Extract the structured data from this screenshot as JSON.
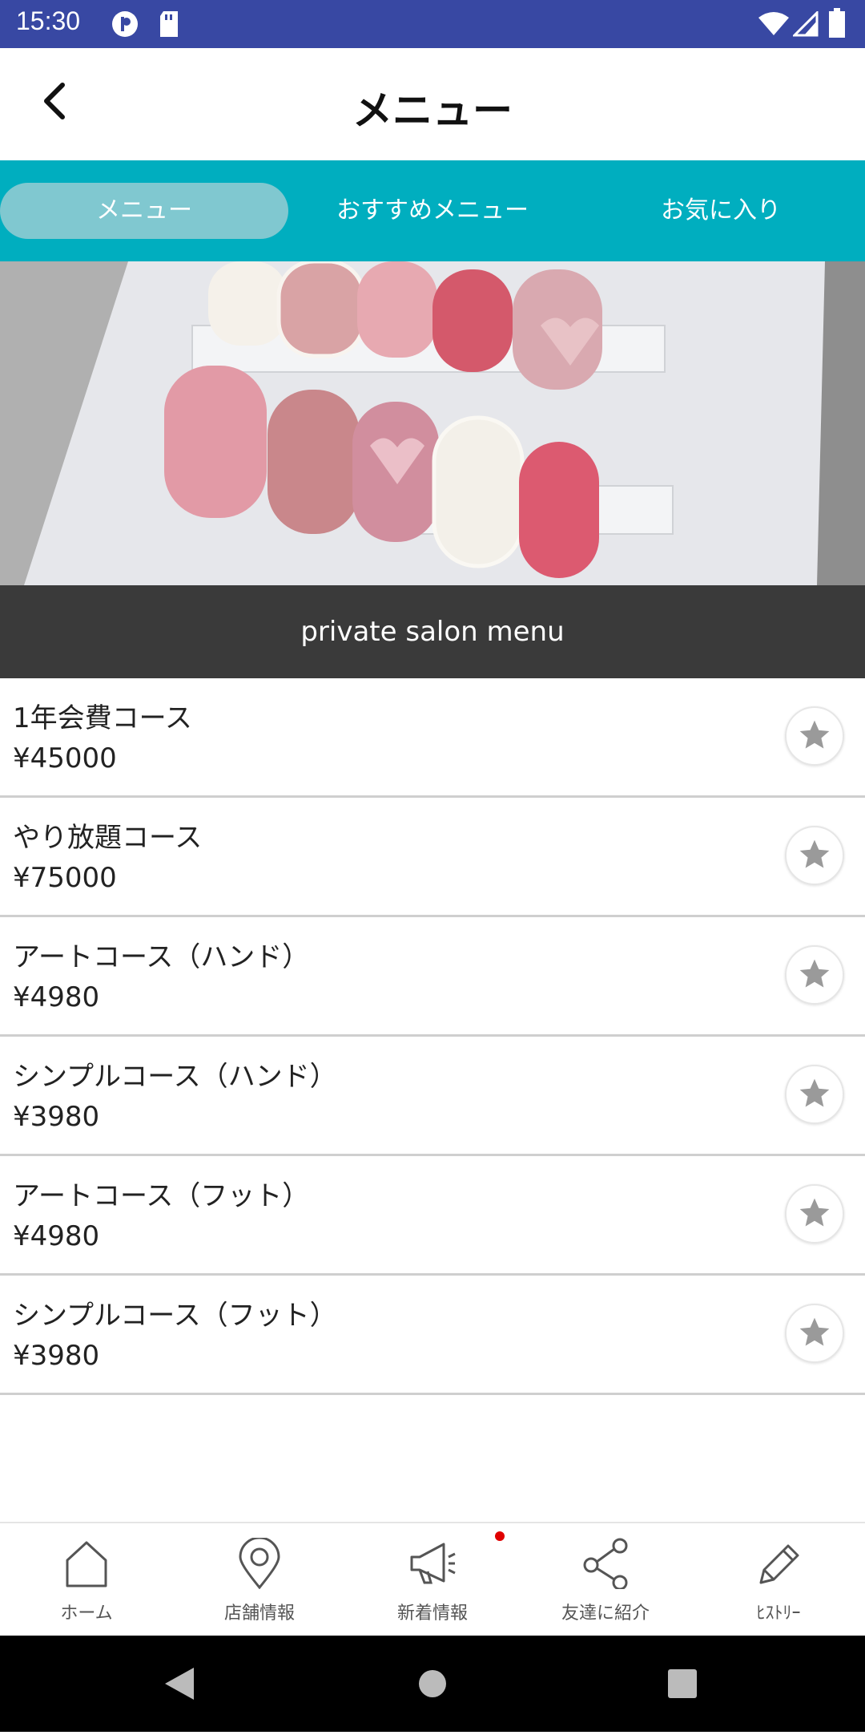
{
  "status_bar": {
    "time": "15:30"
  },
  "app_bar": {
    "title": "メニュー"
  },
  "tabs": [
    {
      "label": "メニュー",
      "active": true
    },
    {
      "label": "おすすめメニュー",
      "active": false
    },
    {
      "label": "お気に入り",
      "active": false
    }
  ],
  "banner": {
    "text": "private salon menu"
  },
  "menu_items": [
    {
      "name": "1年会費コース",
      "price": "¥45000"
    },
    {
      "name": "やり放題コース",
      "price": "¥75000"
    },
    {
      "name": "アートコース（ハンド）",
      "price": "¥4980"
    },
    {
      "name": "シンプルコース（ハンド）",
      "price": "¥3980"
    },
    {
      "name": "アートコース（フット）",
      "price": "¥4980"
    },
    {
      "name": "シンプルコース（フット）",
      "price": "¥3980"
    }
  ],
  "bottom_nav": [
    {
      "label": "ホーム",
      "icon": "home-icon"
    },
    {
      "label": "店舗情報",
      "icon": "location-pin-icon"
    },
    {
      "label": "新着情報",
      "icon": "megaphone-icon"
    },
    {
      "label": "友達に紹介",
      "icon": "share-icon"
    },
    {
      "label": "ﾋｽﾄﾘｰ",
      "icon": "pencil-icon"
    }
  ],
  "colors": {
    "status_bar": "#3848a3",
    "tab_bar": "#00aebf",
    "tab_active": "#80c8d0",
    "banner": "#3a3a3a",
    "badge": "#e00000"
  }
}
